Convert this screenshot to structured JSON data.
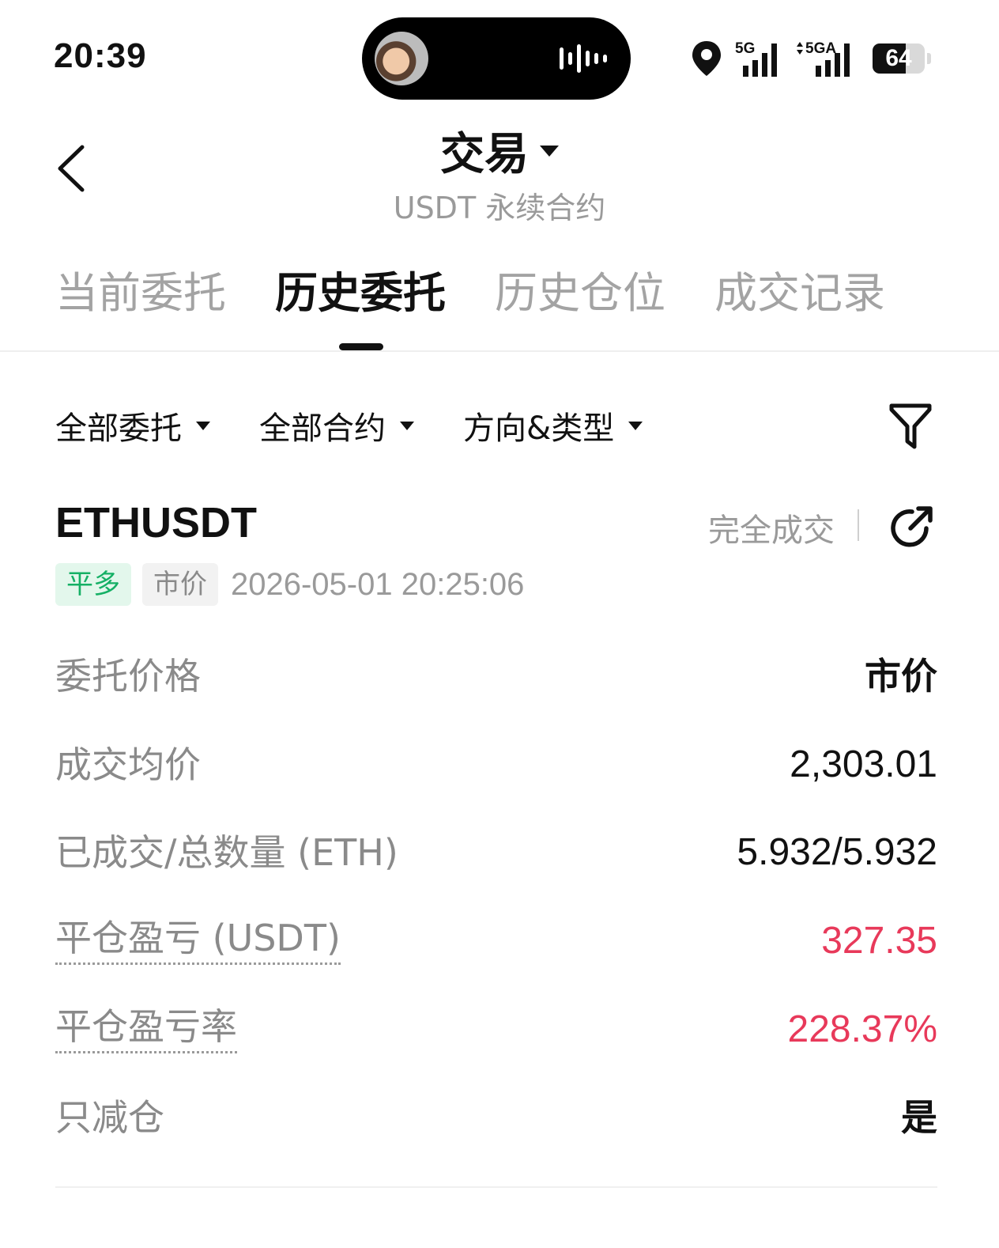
{
  "status_bar": {
    "time": "20:39",
    "network_1": "5G",
    "network_2": "5GA",
    "battery_level": "64",
    "battery_fraction": 0.64
  },
  "header": {
    "title": "交易",
    "subtitle": "USDT 永续合约"
  },
  "tabs": [
    {
      "label": "当前委托",
      "active": false
    },
    {
      "label": "历史委托",
      "active": true
    },
    {
      "label": "历史仓位",
      "active": false
    },
    {
      "label": "成交记录",
      "active": false
    }
  ],
  "filters": [
    {
      "label": "全部委托"
    },
    {
      "label": "全部合约"
    },
    {
      "label": "方向&类型"
    }
  ],
  "order": {
    "symbol": "ETHUSDT",
    "status": "完全成交",
    "side_tag": "平多",
    "type_tag": "市价",
    "time": "2026-05-01 20:25:06",
    "details": [
      {
        "label": "委托价格",
        "value": "市价"
      },
      {
        "label": "成交均价",
        "value": "2,303.01"
      },
      {
        "label": "已成交/总数量 (ETH)",
        "value": "5.932/5.932"
      },
      {
        "label": "平仓盈亏 (USDT)",
        "value": "327.35"
      },
      {
        "label": "平仓盈亏率",
        "value": "228.37%"
      },
      {
        "label": "只减仓",
        "value": "是"
      }
    ]
  },
  "colors": {
    "profit": "#e8395a",
    "long_tag_text": "#15b065",
    "long_tag_bg": "#e3f7ec",
    "muted_text": "#9a9a9a"
  }
}
